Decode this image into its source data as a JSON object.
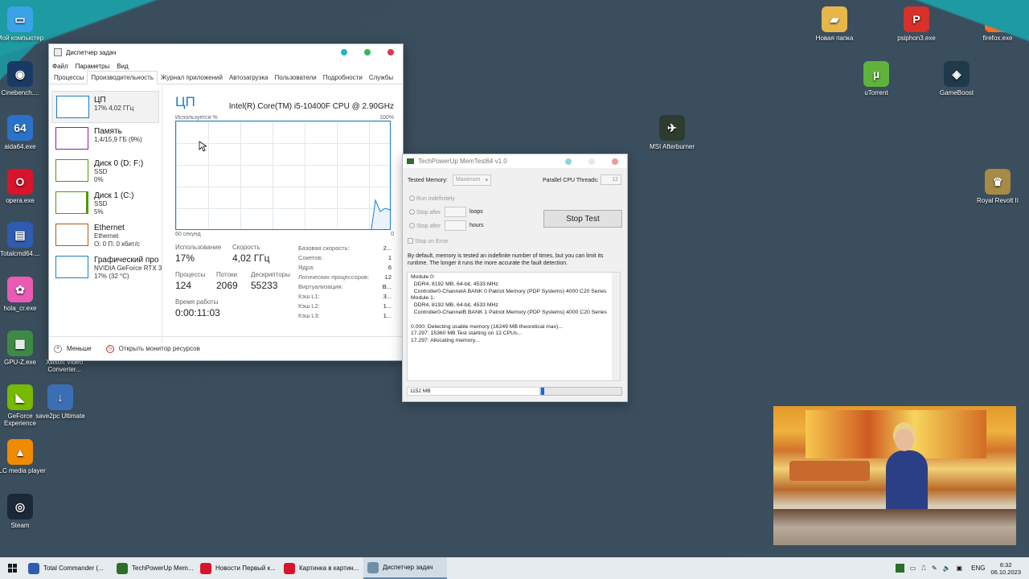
{
  "desktop_icons": [
    {
      "label": "Мой компьютер",
      "color": "#3aa3e8",
      "glyph": "▭"
    },
    {
      "label": "Cinebench....",
      "color": "#1a3a66",
      "glyph": "◉"
    },
    {
      "label": "aida64.exe",
      "color": "#2a72c9",
      "glyph": "64"
    },
    {
      "label": "opera.exe",
      "color": "#d9142a",
      "glyph": "O"
    },
    {
      "label": "Totalcmd64....",
      "color": "#2f5bb0",
      "glyph": "▤"
    },
    {
      "label": "hola_cr.exe",
      "color": "#e95bb5",
      "glyph": "✿"
    },
    {
      "label": "GPU-Z.exe",
      "color": "#3d8a44",
      "glyph": "▦"
    },
    {
      "label": "GeForce Experience",
      "color": "#76b900",
      "glyph": "◣"
    },
    {
      "label": "VLC media player",
      "color": "#f08a00",
      "glyph": "▲"
    },
    {
      "label": "Steam",
      "color": "#1b2838",
      "glyph": "◎"
    },
    {
      "label": "Xilisoft Video Converter...",
      "color": "#3a3a3a",
      "glyph": "▣"
    },
    {
      "label": "save2pc Ultimate",
      "color": "#3b6fb5",
      "glyph": "↓"
    },
    {
      "label": "Новая папка",
      "color": "#e7b74a",
      "glyph": "▰"
    },
    {
      "label": "psiphon3.exe",
      "color": "#d8302a",
      "glyph": "P"
    },
    {
      "label": "firefox.exe",
      "color": "#ff6d1f",
      "glyph": "◐"
    },
    {
      "label": "uTorrent",
      "color": "#5fb33b",
      "glyph": "µ"
    },
    {
      "label": "GameBoost",
      "color": "#1f3a4b",
      "glyph": "◈"
    },
    {
      "label": "MSI Afterburner",
      "color": "#2d3c2e",
      "glyph": "✈"
    },
    {
      "label": "Royal Revolt II",
      "color": "#a68a45",
      "glyph": "♛"
    }
  ],
  "task_manager": {
    "title": "Диспетчер задач",
    "menu": [
      "Файл",
      "Параметры",
      "Вид"
    ],
    "tabs": [
      "Процессы",
      "Производительность",
      "Журнал приложений",
      "Автозагрузка",
      "Пользователи",
      "Подробности",
      "Службы"
    ],
    "active_tab": 1,
    "sidebar": [
      {
        "name": "ЦП",
        "line1": "17% 4,02 ГГц",
        "line2": "",
        "color": "#1a7ec8"
      },
      {
        "name": "Память",
        "line1": "1,4/15,9 ГБ (9%)",
        "line2": "",
        "color": "#8b1ea3"
      },
      {
        "name": "Диск 0 (D: F:)",
        "line1": "SSD",
        "line2": "0%",
        "color": "#4e9a06"
      },
      {
        "name": "Диск 1 (C:)",
        "line1": "SSD",
        "line2": "5%",
        "color": "#4e9a06"
      },
      {
        "name": "Ethernet",
        "line1": "Ethernet",
        "line2": "О: 0 П: 0 кбит/с",
        "color": "#a65d1e"
      },
      {
        "name": "Графический про",
        "line1": "NVIDIA GeForce RTX 305",
        "line2": "17% (32 °C)",
        "color": "#1a7ec8"
      }
    ],
    "cpu_title": "ЦП",
    "cpu_model": "Intel(R) Core(TM) i5-10400F CPU @ 2.90GHz",
    "graph_label_left": "Используется %",
    "graph_label_right": "100%",
    "graph_bottom_left": "60 секунд",
    "graph_bottom_right": "0",
    "usage_label": "Использование",
    "usage_value": "17%",
    "speed_label": "Скорость",
    "speed_value": "4,02 ГГц",
    "proc_label": "Процессы",
    "proc_value": "124",
    "threads_label": "Потоки",
    "threads_value": "2069",
    "handles_label": "Дескрипторы",
    "handles_value": "55233",
    "uptime_label": "Время работы",
    "uptime_value": "0:00:11:03",
    "specs": [
      {
        "k": "Базовая скорость:",
        "v": "2..."
      },
      {
        "k": "Сокетов:",
        "v": "1"
      },
      {
        "k": "Ядра:",
        "v": "6"
      },
      {
        "k": "Логических процессоров:",
        "v": "12"
      },
      {
        "k": "Виртуализация:",
        "v": "В..."
      },
      {
        "k": "Кэш L1:",
        "v": "3..."
      },
      {
        "k": "Кэш L2:",
        "v": "1..."
      },
      {
        "k": "Кэш L3:",
        "v": "1..."
      }
    ],
    "footer_less": "Меньше",
    "footer_monitor": "Открыть монитор ресурсов"
  },
  "memtest": {
    "title": "TechPowerUp MemTest64 v1.0",
    "tested_memory_label": "Tested Memory:",
    "tested_memory_value": "Maximum",
    "threads_label": "Parallel CPU Threads:",
    "threads_value": "12",
    "run_indef": "Run indefinitely",
    "stop_after": "Stop after",
    "loops": "loops",
    "hours": "hours",
    "stop_on_error": "Stop on Error",
    "stop_button": "Stop Test",
    "description": "By default, memory is tested an indefinite number of times, but you can limit its runtime. The longer it runs the more accurate the fault detection.",
    "log": [
      "Module 0:",
      "  DDR4, 8192 MB, 64-bit, 4533 MHz",
      "  Controller0-ChannelA BANK 0 Patriot Memory (PDP Systems) 4000 C20 Series",
      "Module 1:",
      "  DDR4, 8192 MB, 64-bit, 4533 MHz",
      "  Controller0-ChannelB BANK 1 Patriot Memory (PDP Systems) 4000 C20 Series",
      "",
      "0.000: Detecting usable memory (16249 MB theoretical max)...",
      "17.297: 15360 MB Test starting on 12 CPUs...",
      "17.297: Allocating memory..."
    ],
    "mem_used": "1152 MB",
    "progress": 0.04
  },
  "taskbar": {
    "items": [
      {
        "label": "Total Commander (...",
        "color": "#2f5bb0"
      },
      {
        "label": "TechPowerUp Mem...",
        "color": "#2c6e2a"
      },
      {
        "label": "Новости Первый к...",
        "color": "#d9142a"
      },
      {
        "label": "Картинка в картин...",
        "color": "#d9142a"
      },
      {
        "label": "Диспетчер задач",
        "color": "#6f8fa8"
      }
    ],
    "lang": "ENG",
    "time": "6:32",
    "date": "06.10.2023"
  }
}
